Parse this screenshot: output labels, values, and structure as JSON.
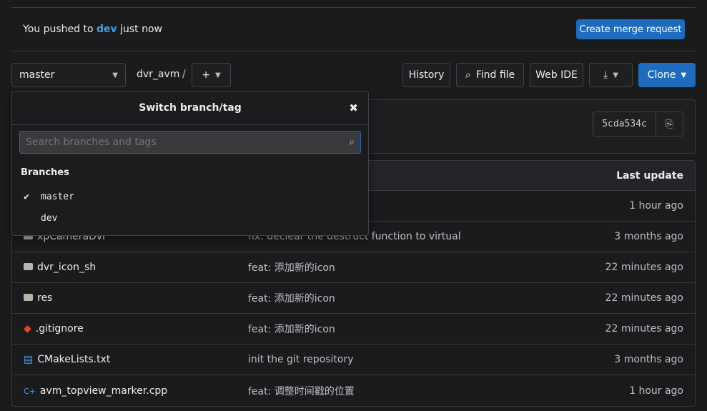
{
  "banner": {
    "prefix": "You pushed to",
    "branch": "dev",
    "suffix": "just now",
    "button": "Create merge request"
  },
  "toolbar": {
    "branch": "master",
    "repo": "dvr_avm",
    "separator": "/",
    "add": "+",
    "history": "History",
    "find_file": "Find file",
    "web_ide": "Web IDE",
    "clone": "Clone"
  },
  "commit": {
    "sha": "5cda534c"
  },
  "dropdown": {
    "title": "Switch branch/tag",
    "search_placeholder": "Search branches and tags",
    "section": "Branches",
    "branches": [
      {
        "name": "master",
        "selected": true
      },
      {
        "name": "dev",
        "selected": false
      }
    ]
  },
  "table": {
    "header_last_update": "Last update",
    "rows": [
      {
        "name": "",
        "message": "",
        "time": "1 hour ago",
        "icon": "folder-icon"
      },
      {
        "name": "xpCameraDvr",
        "message": "fix: declear the destruct function to virtual",
        "time": "3 months ago",
        "icon": "folder-icon"
      },
      {
        "name": "dvr_icon_sh",
        "message": "feat: 添加新的icon",
        "time": "22 minutes ago",
        "icon": "folder-icon"
      },
      {
        "name": "res",
        "message": "feat: 添加新的icon",
        "time": "22 minutes ago",
        "icon": "folder-icon"
      },
      {
        "name": ".gitignore",
        "message": "feat: 添加新的icon",
        "time": "22 minutes ago",
        "icon": "git-icon"
      },
      {
        "name": "CMakeLists.txt",
        "message": "init the git repository",
        "time": "3 months ago",
        "icon": "file-text-icon"
      },
      {
        "name": "avm_topview_marker.cpp",
        "message": "feat: 调整时间戳的位置",
        "time": "1 hour ago",
        "icon": "cpp-icon"
      }
    ]
  },
  "colors": {
    "accent": "#1f6bbd",
    "link": "#4a9bec",
    "git": "#e24329",
    "file": "#4a9bec"
  }
}
